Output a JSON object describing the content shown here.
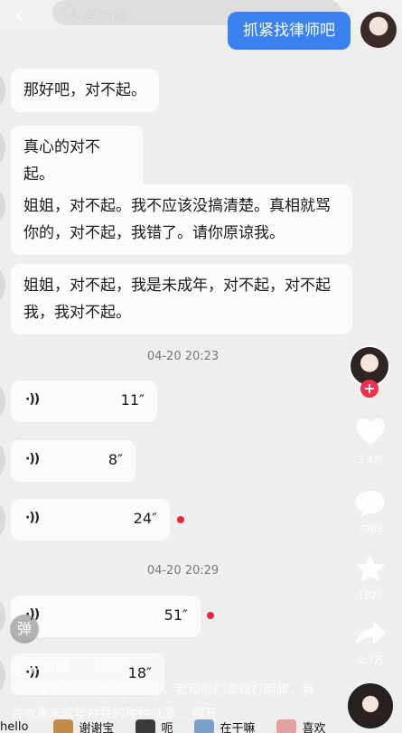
{
  "header": {
    "back_label": "‹",
    "search_query": "辛雨锡",
    "search_button": "搜索"
  },
  "chat": {
    "sent_message": "抓紧找律师吧",
    "messages": [
      "那好吧，对不起。",
      "真心的对不起。",
      "姐姐，对不起。我不应该没搞清楚。真相就骂你的，对不起，我错了。请你原谅我。",
      "姐姐，对不起，我是未成年，对不起，对不起我，我对不起。"
    ],
    "timestamp_1": "04-20 20:23",
    "voice_group_1": [
      {
        "duration": "11″",
        "unread": false
      },
      {
        "duration": "8″",
        "unread": false
      },
      {
        "duration": "24″",
        "unread": true
      }
    ],
    "timestamp_2": "04-20 20:29",
    "voice_group_2": [
      {
        "duration": "51″",
        "unread": true
      },
      {
        "duration": "18″",
        "unread": false
      }
    ],
    "voice_symbol": "·))"
  },
  "side_actions": {
    "follow_symbol": "+",
    "likes": "3.4万",
    "comments": "7003",
    "favorites": "1927",
    "shares": "2.7万"
  },
  "post": {
    "danmu_label": "弹",
    "author": "@辛雨锡",
    "time": "· 1天前",
    "caption": "和秦霄贤谈场恋爱倒霉六年，我和你们秦粉打明牌，我会收集未成年对我的种种过激… 展开"
  },
  "bottom_bar": {
    "items": [
      "hello",
      "谢谢宝",
      "呃",
      "在干嘛",
      "喜欢"
    ]
  },
  "colors": {
    "sent_bubble": "#3b82f0",
    "unread_dot": "#e8253b",
    "follow": "#f2304a"
  }
}
